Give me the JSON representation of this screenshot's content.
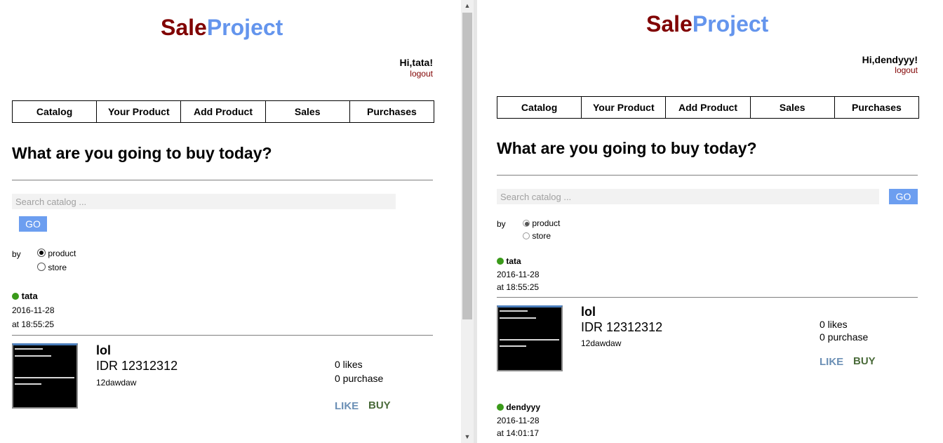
{
  "logo": {
    "part1": "Sale",
    "part2": "Project"
  },
  "left": {
    "greeting": "Hi,tata!",
    "logout": "logout",
    "nav": [
      "Catalog",
      "Your Product",
      "Add Product",
      "Sales",
      "Purchases"
    ],
    "headline": "What are you going to buy today?",
    "search": {
      "placeholder": "Search catalog ...",
      "button": "GO"
    },
    "filter": {
      "by": "by",
      "options": [
        "product",
        "store"
      ],
      "selected": "product"
    },
    "listing": {
      "seller": "tata",
      "date": "2016-11-28",
      "time": "at 18:55:25",
      "product": {
        "name": "lol",
        "price": "IDR 12312312",
        "description": "12dawdaw"
      },
      "likes": "0 likes",
      "purchases": "0 purchase",
      "like_label": "LIKE",
      "buy_label": "BUY"
    }
  },
  "right": {
    "greeting": "Hi,dendyyy!",
    "logout": "logout",
    "nav": [
      "Catalog",
      "Your Product",
      "Add Product",
      "Sales",
      "Purchases"
    ],
    "headline": "What are you going to buy today?",
    "search": {
      "placeholder": "Search catalog ...",
      "button": "GO"
    },
    "filter": {
      "by": "by",
      "options": [
        "product",
        "store"
      ],
      "selected": "product"
    },
    "listings": [
      {
        "seller": "tata",
        "date": "2016-11-28",
        "time": "at 18:55:25",
        "product": {
          "name": "lol",
          "price": "IDR 12312312",
          "description": "12dawdaw"
        },
        "likes": "0 likes",
        "purchases": "0 purchase",
        "like_label": "LIKE",
        "buy_label": "BUY"
      },
      {
        "seller": "dendyyy",
        "date": "2016-11-28",
        "time": "at 14:01:17"
      }
    ]
  },
  "colors": {
    "sale": "#800000",
    "project": "#6495ed",
    "go_button": "#6c9ef0",
    "online_dot": "#3a9a1a",
    "like": "#6b8fb5",
    "buy": "#4a6b3a"
  },
  "icons": {
    "scroll_up": "triangle-up-icon",
    "scroll_down": "triangle-down-icon",
    "online": "online-dot-icon"
  }
}
